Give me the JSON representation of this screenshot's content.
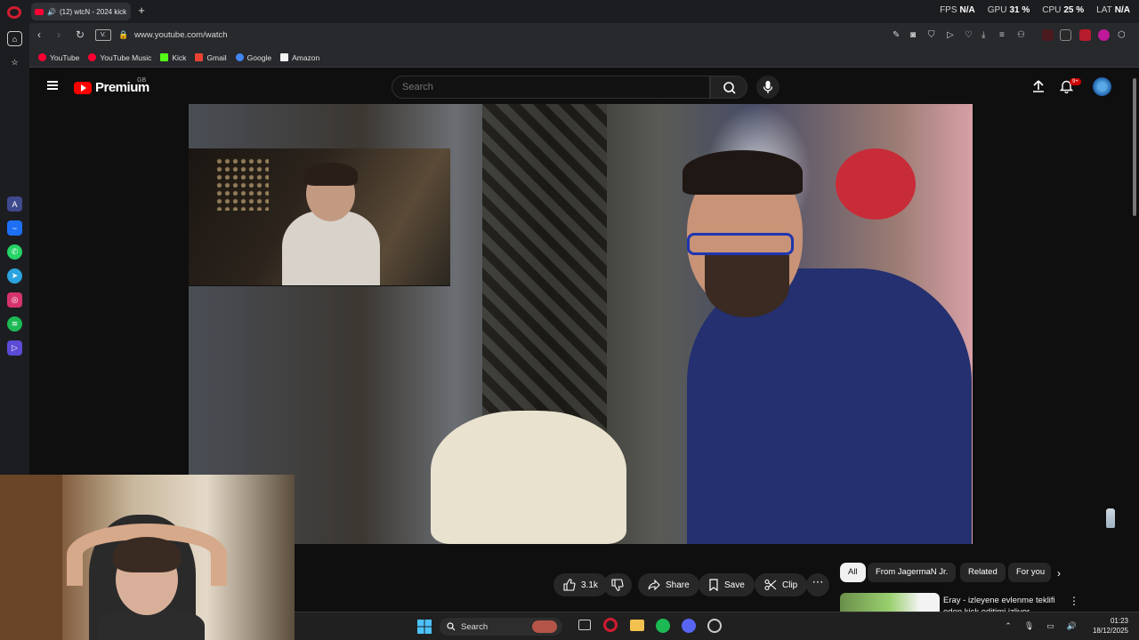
{
  "browser": {
    "tab_title": "(12) wtcN - 2024 kick",
    "tab_close": "✕",
    "new_tab": "+",
    "perf": [
      {
        "label": "FPS",
        "value": "N/A"
      },
      {
        "label": "GPU",
        "value": "31 %"
      },
      {
        "label": "CPU",
        "value": "25 %"
      },
      {
        "label": "LAT",
        "value": "N/A"
      }
    ],
    "url_badge": "V.",
    "url": "www.youtube.com/watch",
    "bookmarks": [
      {
        "label": "YouTube",
        "color": "#ff0033"
      },
      {
        "label": "YouTube Music",
        "color": "#ff0033"
      },
      {
        "label": "Kick",
        "color": "#53fc18"
      },
      {
        "label": "Gmail",
        "color": "#ea4335"
      },
      {
        "label": "Google",
        "color": "#4285f4"
      },
      {
        "label": "Amazon",
        "color": "#f3f3f3"
      }
    ]
  },
  "youtube": {
    "logo_text": "Premium",
    "country_code": "GB",
    "search_placeholder": "Search",
    "notif_badge": "9+",
    "actions": {
      "likes": "3.1k",
      "share": "Share",
      "save": "Save",
      "clip": "Clip",
      "more": "⋯"
    },
    "chips": [
      "All",
      "From JagermaN Jr.",
      "Related",
      "For you"
    ],
    "recommendation": {
      "title": "Eray - izleyene evlenme teklifi eden kick editimi izliyor"
    }
  },
  "taskbar": {
    "search_label": "Search",
    "time": "01:23",
    "date": "18/12/2025"
  },
  "colors": {
    "yt_bg": "#0f0f0f",
    "yt_red": "#ff0000",
    "opera_red": "#d01c30",
    "pill_bg": "#272727"
  }
}
